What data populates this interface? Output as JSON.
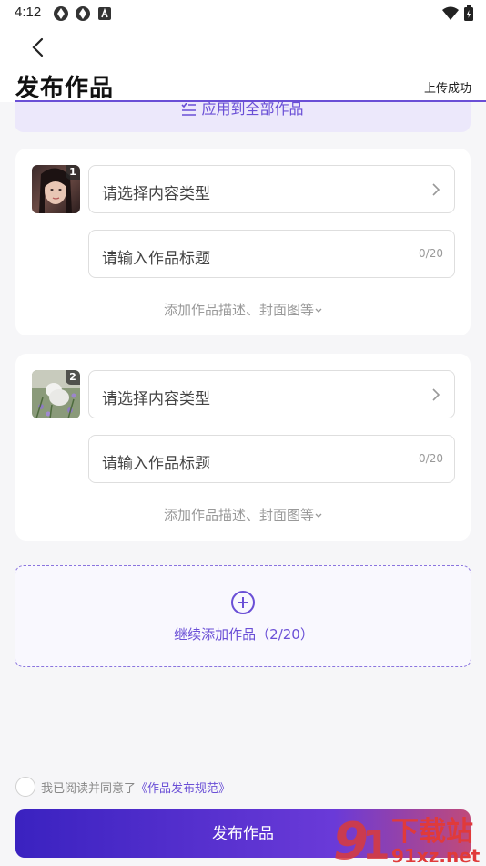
{
  "status_bar": {
    "time": "4:12",
    "icons": [
      "app-icon-1",
      "app-icon-2",
      "notification-a-icon"
    ],
    "right_icons": [
      "wifi-icon",
      "battery-icon"
    ]
  },
  "header": {
    "back_icon": "chevron-left-icon",
    "title": "发布作品",
    "upload_status": "上传成功",
    "accent_color": "#6a4fd6"
  },
  "apply_all": {
    "icon": "list-check-icon",
    "label": "应用到全部作品"
  },
  "works": [
    {
      "index": "1",
      "type_placeholder": "请选择内容类型",
      "title_placeholder": "请输入作品标题",
      "title_counter": "0/20",
      "more_label": "添加作品描述、封面图等"
    },
    {
      "index": "2",
      "type_placeholder": "请选择内容类型",
      "title_placeholder": "请输入作品标题",
      "title_counter": "0/20",
      "more_label": "添加作品描述、封面图等"
    }
  ],
  "add_more": {
    "icon": "plus-circle-icon",
    "label": "继续添加作品（2/20）"
  },
  "agreement": {
    "prefix": "我已阅读并同意了",
    "link": "《作品发布规范》"
  },
  "publish_button": {
    "label": "发布作品"
  },
  "watermark": {
    "line1": "下载站",
    "line2": "91xz.net"
  }
}
